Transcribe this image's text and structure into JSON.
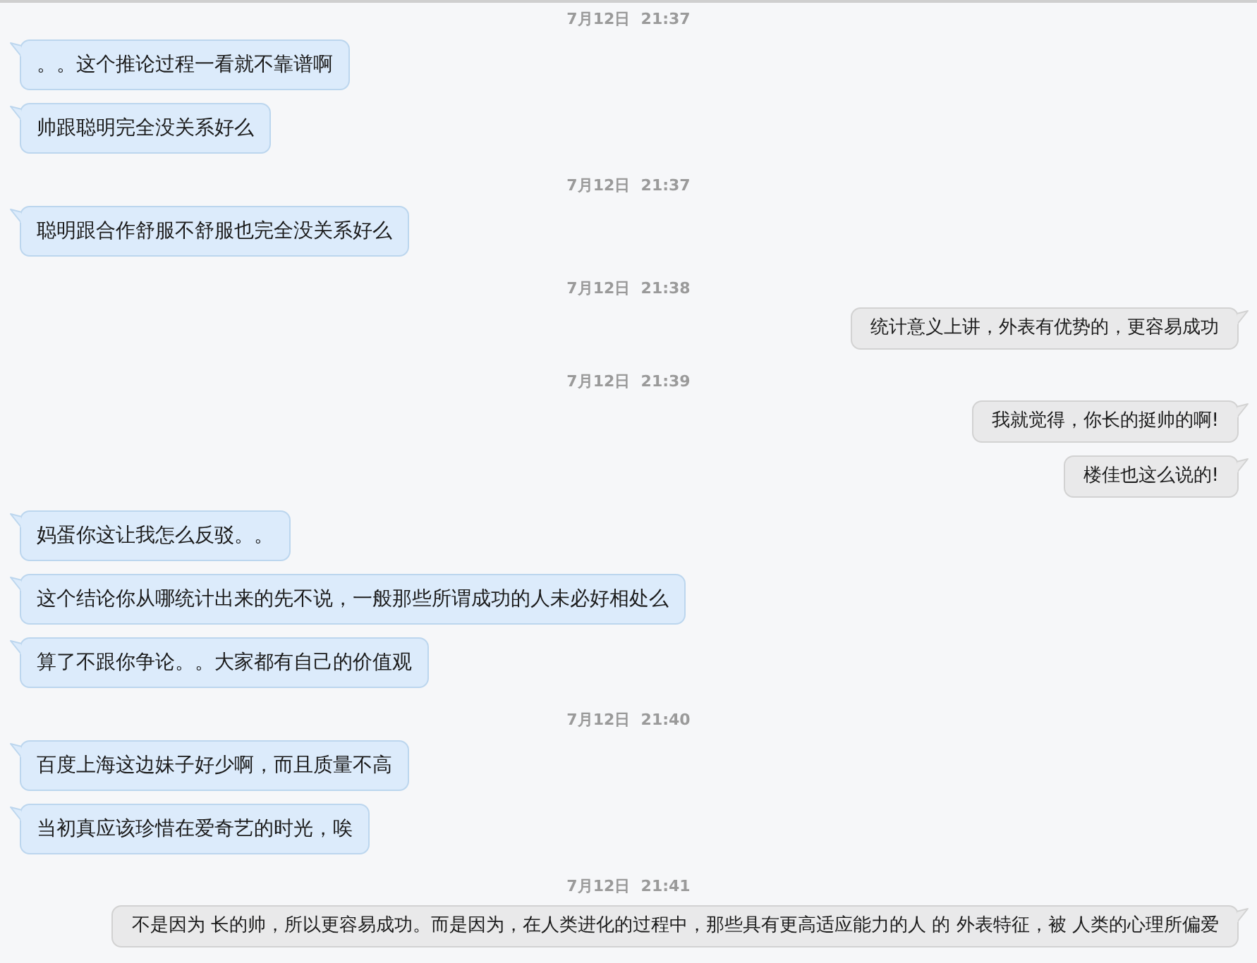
{
  "messages": [
    {
      "kind": "timestamp",
      "text": "7月12日  21:37"
    },
    {
      "kind": "incoming",
      "text": "。。这个推论过程一看就不靠谱啊"
    },
    {
      "kind": "incoming",
      "text": "帅跟聪明完全没关系好么"
    },
    {
      "kind": "timestamp",
      "text": "7月12日  21:37"
    },
    {
      "kind": "incoming",
      "text": "聪明跟合作舒服不舒服也完全没关系好么"
    },
    {
      "kind": "timestamp",
      "text": "7月12日  21:38"
    },
    {
      "kind": "outgoing",
      "text": "统计意义上讲，外表有优势的，更容易成功"
    },
    {
      "kind": "timestamp",
      "text": "7月12日  21:39"
    },
    {
      "kind": "outgoing",
      "text": "我就觉得，你长的挺帅的啊!"
    },
    {
      "kind": "outgoing",
      "text": "楼佳也这么说的!"
    },
    {
      "kind": "incoming",
      "text": "妈蛋你这让我怎么反驳。。"
    },
    {
      "kind": "incoming",
      "text": "这个结论你从哪统计出来的先不说，一般那些所谓成功的人未必好相处么"
    },
    {
      "kind": "incoming",
      "text": "算了不跟你争论。。大家都有自己的价值观"
    },
    {
      "kind": "timestamp",
      "text": "7月12日  21:40"
    },
    {
      "kind": "incoming",
      "text": "百度上海这边妹子好少啊，而且质量不高"
    },
    {
      "kind": "incoming",
      "text": "当初真应该珍惜在爱奇艺的时光，唉"
    },
    {
      "kind": "timestamp",
      "text": "7月12日  21:41"
    },
    {
      "kind": "outgoing",
      "text": "不是因为 长的帅，所以更容易成功。而是因为，在人类进化的过程中，那些具有更高适应能力的人 的 外表特征，被 人类的心理所偏爱"
    }
  ]
}
